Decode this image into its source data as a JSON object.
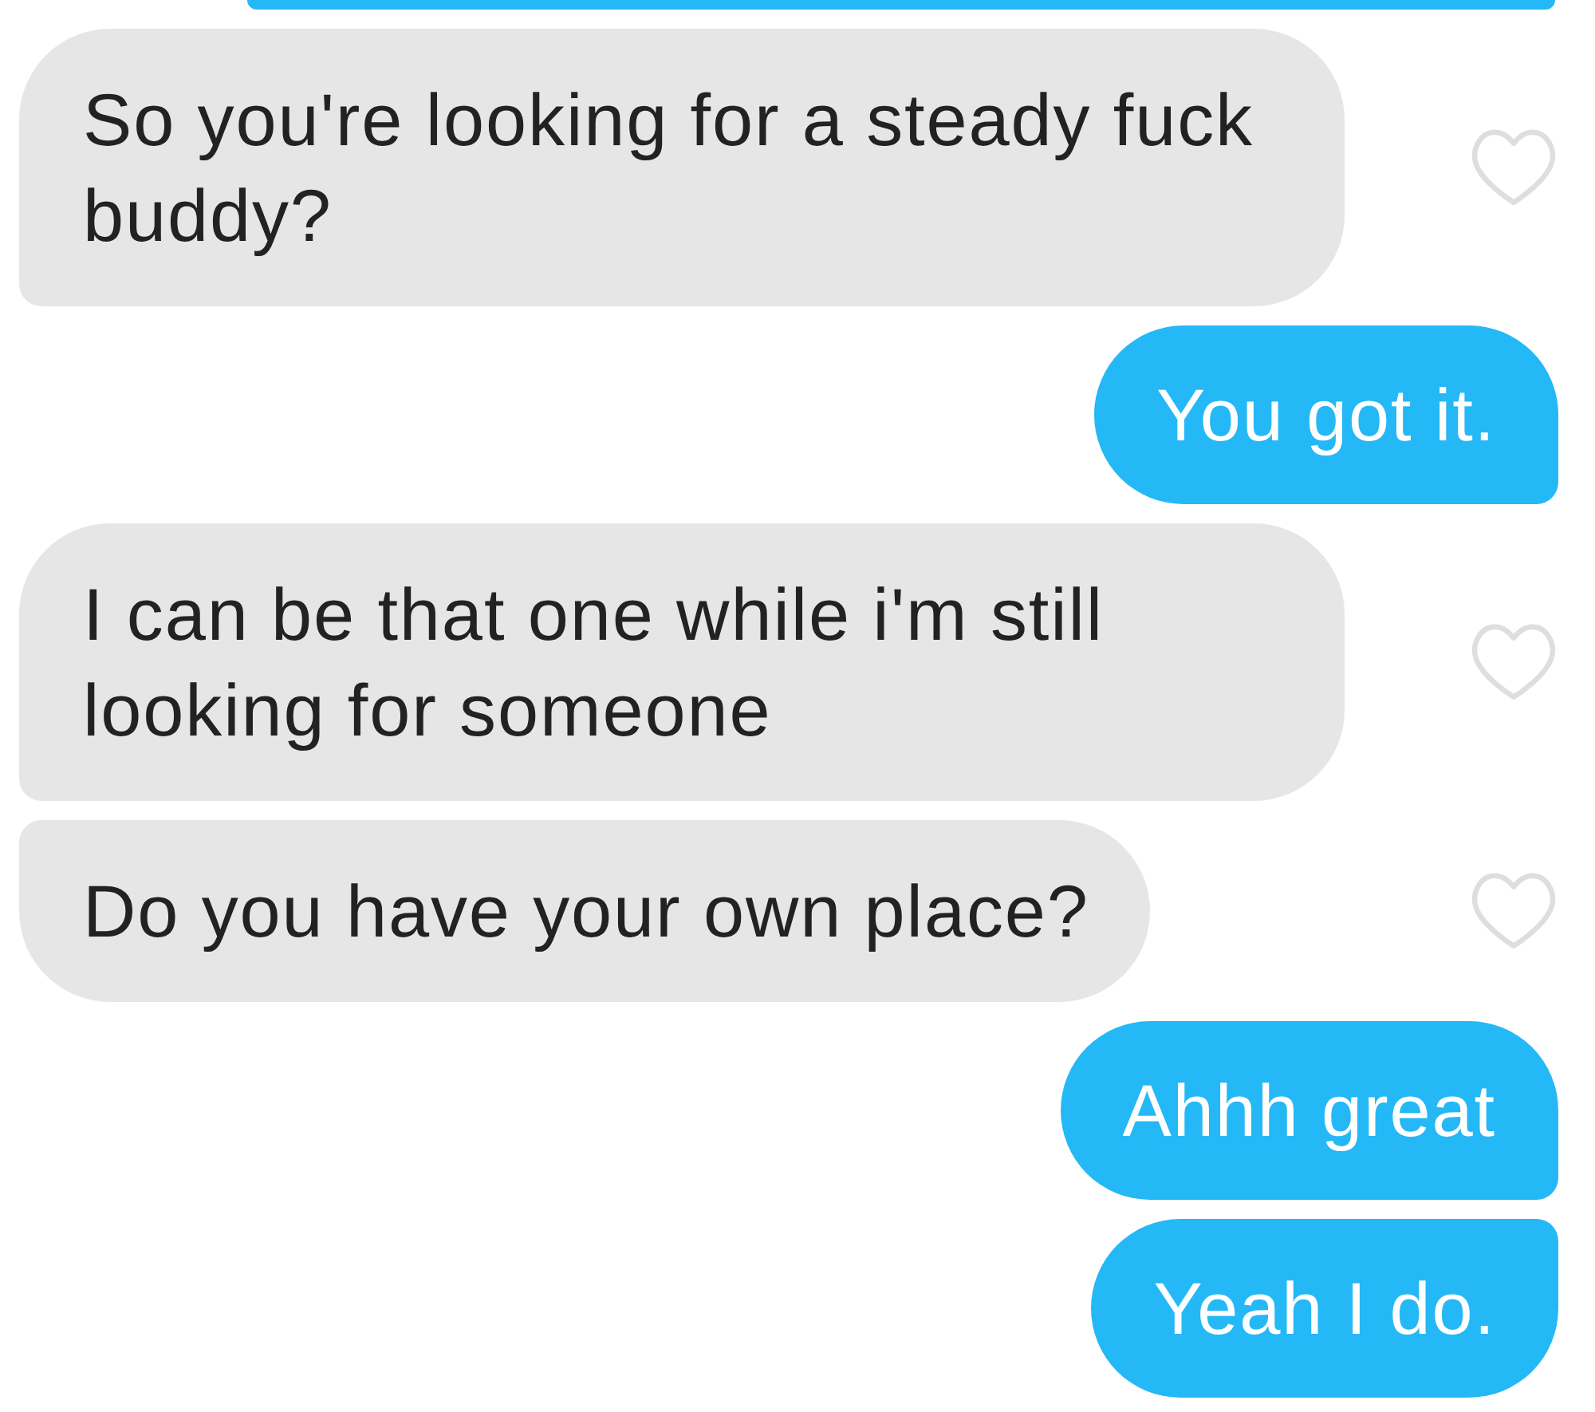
{
  "messages": [
    {
      "kind": "received",
      "text": "So you're looking for a steady fuck buddy?",
      "liked": false
    },
    {
      "kind": "sent",
      "text": "You got it."
    },
    {
      "kind": "received",
      "text": "I can be that one while i'm still looking for someone",
      "liked": false
    },
    {
      "kind": "received",
      "text": "Do you have your own place?",
      "liked": false
    },
    {
      "kind": "sent",
      "text": "Ahhh great"
    },
    {
      "kind": "sent",
      "text": "Yeah I do."
    }
  ]
}
